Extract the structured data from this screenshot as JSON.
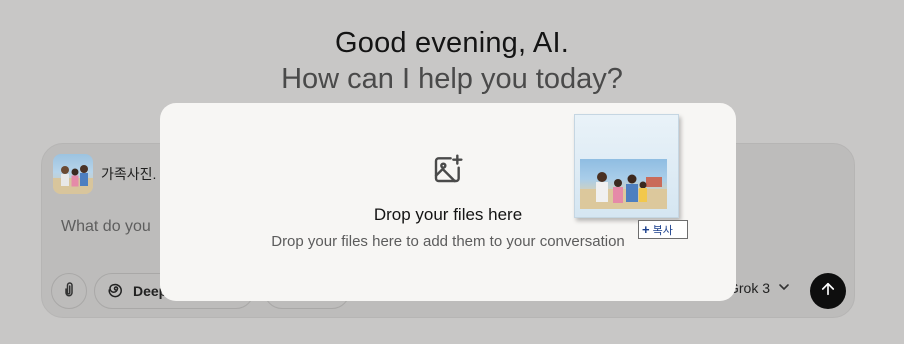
{
  "greeting": "Good evening, AI.",
  "subgreeting": "How can I help you today?",
  "composer": {
    "attachment_name": "가족사진.",
    "input_placeholder": "What do you ",
    "deep_search_label": "Deep",
    "model_label": "Grok 3"
  },
  "dropzone": {
    "title": "Drop your files here",
    "subtitle": "Drop your files here to add them to your conversation",
    "copy_label": "복사"
  },
  "icons": {
    "attach": "paperclip-icon",
    "deep_search": "swirl-icon",
    "model_dropdown": "chevron-down-icon",
    "send": "arrow-up-icon",
    "drop": "image-plus-icon",
    "copy": "plus-icon"
  },
  "colors": {
    "background": "#c8c7c6",
    "overlay": "#f7f6f4",
    "send_button": "#0e0e0e",
    "copy_text": "#1a3f8c"
  }
}
